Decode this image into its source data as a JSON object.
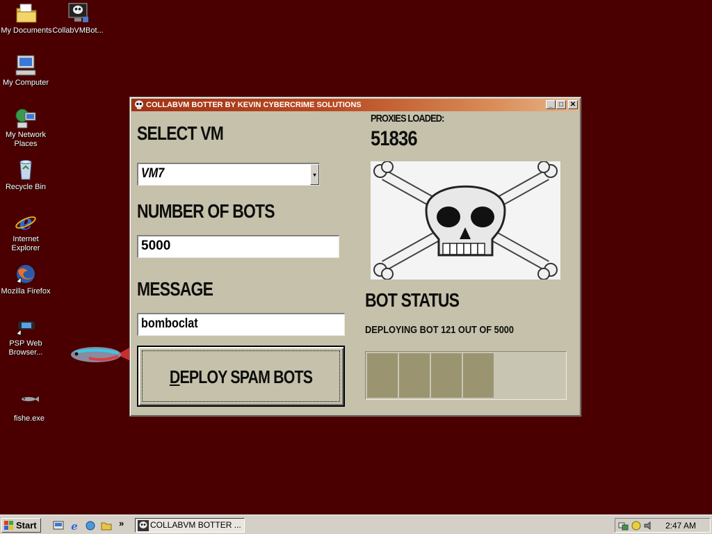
{
  "desktop": {
    "icons": [
      {
        "label": "My Documents",
        "icon": "folder-documents-icon"
      },
      {
        "label": "CollabVMBot...",
        "icon": "skull-exe-icon"
      },
      {
        "label": "My Computer",
        "icon": "computer-icon"
      },
      {
        "label": "My Network Places",
        "icon": "network-icon"
      },
      {
        "label": "Recycle Bin",
        "icon": "recycle-bin-icon"
      },
      {
        "label": "Internet Explorer",
        "icon": "ie-icon"
      },
      {
        "label": "Mozilla Firefox",
        "icon": "firefox-icon"
      },
      {
        "label": "PSP Web Browser...",
        "icon": "psp-icon"
      },
      {
        "label": "fishe.exe",
        "icon": "fish-icon"
      }
    ]
  },
  "window": {
    "title": "COLLABVM BOTTER BY KEVIN CYBERCRIME SOLUTIONS",
    "minimize": "_",
    "maximize": "□",
    "close": "✕",
    "select_vm_label": "SELECT VM",
    "selected_vm": "VM7",
    "bots_label": "NUMBER OF BOTS",
    "bots_value": "5000",
    "message_label": "MESSAGE",
    "message_value": "bomboclat",
    "deploy_label": "DEPLOY SPAM BOTS",
    "proxies_label": "PROXIES LOADED:",
    "proxies_value": "51836",
    "status_label": "BOT STATUS",
    "status_text": "DEPLOYING BOT 121 OUT OF 5000",
    "progress_blocks_filled": 4,
    "accent_title": "#a13216"
  },
  "taskbar": {
    "start_label": "Start",
    "task_label": "COLLABVM BOTTER ...",
    "clock": "2:47 AM",
    "overflow": "»"
  }
}
